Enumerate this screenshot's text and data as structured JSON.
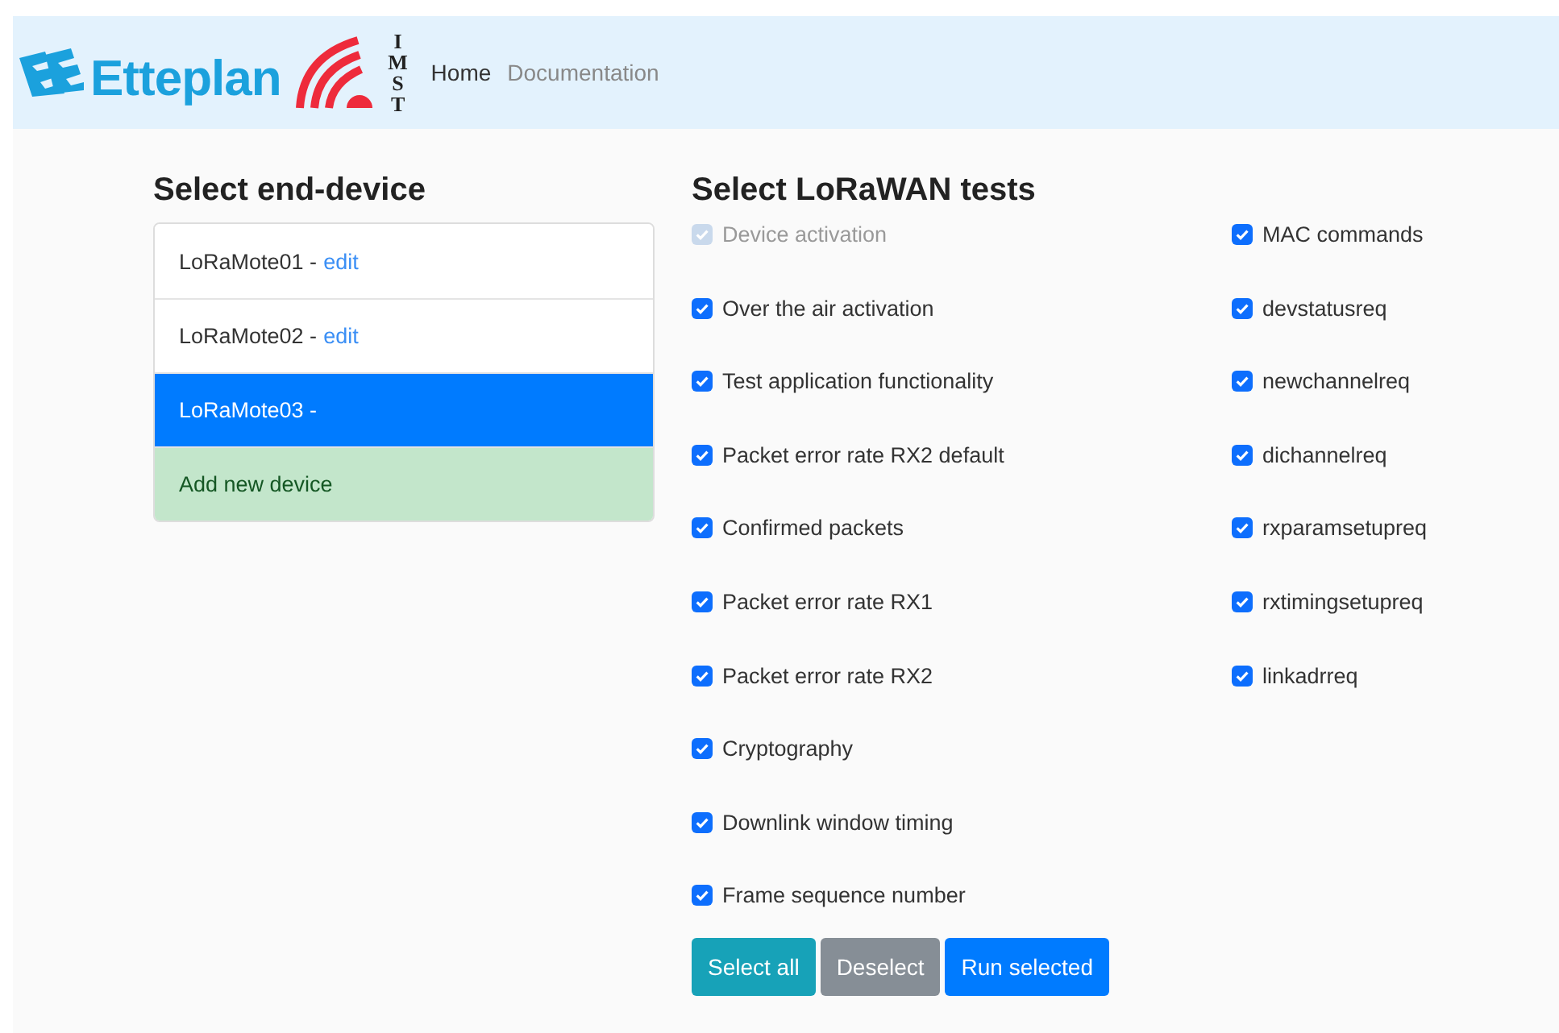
{
  "header": {
    "logo_text": "Etteplan",
    "partner_logo_text": "IMST",
    "nav": [
      {
        "label": "Home",
        "selected": true
      },
      {
        "label": "Documentation",
        "selected": false
      }
    ]
  },
  "devices": {
    "title": "Select end-device",
    "items": [
      {
        "kind": "device",
        "name": "LoRaMote01 -",
        "edit": "edit",
        "selected": false
      },
      {
        "kind": "device",
        "name": "LoRaMote02 -",
        "edit": "edit",
        "selected": false
      },
      {
        "kind": "device",
        "name": "LoRaMote03 -",
        "selected": true
      },
      {
        "kind": "add",
        "name": "Add new device"
      }
    ]
  },
  "tests": {
    "title": "Select LoRaWAN tests",
    "columns": [
      [
        {
          "label": "Device activation",
          "checked": true,
          "disabled": true
        },
        {
          "label": "Over the air activation",
          "checked": true,
          "disabled": false
        },
        {
          "label": "Test application functionality",
          "checked": true,
          "disabled": false
        },
        {
          "label": "Packet error rate RX2 default",
          "checked": true,
          "disabled": false
        },
        {
          "label": "Confirmed packets",
          "checked": true,
          "disabled": false
        },
        {
          "label": "Packet error rate RX1",
          "checked": true,
          "disabled": false
        },
        {
          "label": "Packet error rate RX2",
          "checked": true,
          "disabled": false
        },
        {
          "label": "Cryptography",
          "checked": true,
          "disabled": false
        },
        {
          "label": "Downlink window timing",
          "checked": true,
          "disabled": false
        },
        {
          "label": "Frame sequence number",
          "checked": true,
          "disabled": false
        }
      ],
      [
        {
          "label": "MAC commands",
          "checked": true,
          "disabled": false
        },
        {
          "label": "devstatusreq",
          "checked": true,
          "disabled": false
        },
        {
          "label": "newchannelreq",
          "checked": true,
          "disabled": false
        },
        {
          "label": "dichannelreq",
          "checked": true,
          "disabled": false
        },
        {
          "label": "rxparamsetupreq",
          "checked": true,
          "disabled": false
        },
        {
          "label": "rxtimingsetupreq",
          "checked": true,
          "disabled": false
        },
        {
          "label": "linkadrreq",
          "checked": true,
          "disabled": false
        }
      ]
    ],
    "buttons": [
      {
        "kind": "info",
        "label": "Select all"
      },
      {
        "kind": "secondary",
        "label": "Deselect"
      },
      {
        "kind": "primary",
        "label": "Run selected"
      }
    ]
  }
}
